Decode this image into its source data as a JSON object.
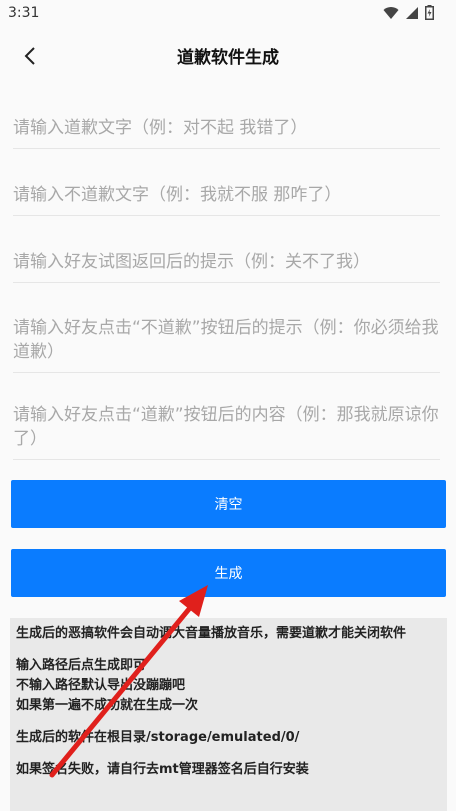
{
  "status": {
    "time": "3:31"
  },
  "header": {
    "title": "道歉软件生成"
  },
  "fields": [
    {
      "placeholder": "请输入道歉文字（例：对不起 我错了）"
    },
    {
      "placeholder": "请输入不道歉文字（例：我就不服 那咋了）"
    },
    {
      "placeholder": "请输入好友试图返回后的提示（例：关不了我）"
    },
    {
      "placeholder": "请输入好友点击“不道歉”按钮后的提示（例：你必须给我道歉）"
    },
    {
      "placeholder": "请输入好友点击“道歉”按钮后的内容（例：那我就原谅你了）"
    }
  ],
  "buttons": {
    "clear": "清空",
    "generate": "生成"
  },
  "info": {
    "line1": "生成后的恶搞软件会自动调大音量播放音乐，需要道歉才能关闭软件",
    "line2": "输入路径后点生成即可",
    "line3": "不输入路径默认导出没蹦蹦吧",
    "line4": "如果第一遍不成功就在生成一次",
    "line5": "生成后的软件在根目录/storage/emulated/0/",
    "line6": "如果签名失败，请自行去mt管理器签名后自行安装"
  },
  "colors": {
    "accent": "#0a7cff",
    "annotation_arrow": "#e0201c"
  }
}
